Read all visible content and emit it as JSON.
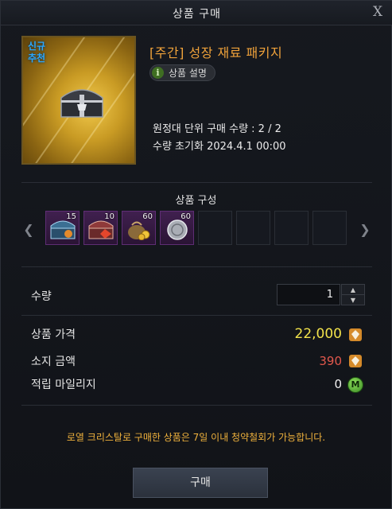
{
  "window": {
    "title": "상품 구매",
    "close_label": "X"
  },
  "product": {
    "badge_line1": "신규",
    "badge_line2": "추천",
    "name": "[주간] 성장 재료 패키지",
    "desc_button": "상품 설명",
    "limit_line": "원정대 단위 구매 수량 : 2 / 2",
    "reset_line": "수량 초기화 2024.4.1 00:00"
  },
  "composition": {
    "title": "상품 구성",
    "items": [
      {
        "icon": "chest-blue-icon",
        "count": "15"
      },
      {
        "icon": "chest-red-icon",
        "count": "10"
      },
      {
        "icon": "gold-pouch-icon",
        "count": "60"
      },
      {
        "icon": "silver-coin-icon",
        "count": "60"
      }
    ],
    "empty_slots": 4
  },
  "purchase": {
    "quantity_label": "수량",
    "quantity_value": "1",
    "price_label": "상품 가격",
    "price_value": "22,000",
    "owned_label": "소지 금액",
    "owned_value": "390",
    "mileage_label": "적립 마일리지",
    "mileage_value": "0",
    "mileage_icon_text": "M"
  },
  "notice": "로열 크리스탈로 구매한 상품은 7일 이내 청약철회가 가능합니다.",
  "buy_button": "구매",
  "colors": {
    "price": "#f2e24b",
    "owned": "#e2584c",
    "product_name": "#f0a23a",
    "notice": "#f0b23c"
  }
}
